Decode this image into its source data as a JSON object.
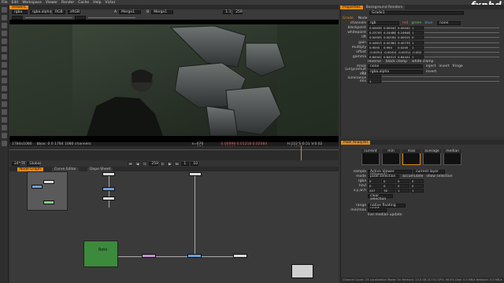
{
  "menu": [
    "File",
    "Edit",
    "Workspace",
    "Viewer",
    "Render",
    "Cache",
    "Help",
    "Victor"
  ],
  "viewer_tab": "Viewer1",
  "viewer_bar": {
    "layer": "rgba",
    "channel": "rgba.alpha",
    "colorspace": "RGB",
    "display": "sRGB",
    "input_a": "A",
    "node_a": "Merge1",
    "input_b": "B",
    "node_b": "Merge1",
    "zoom": "1:1",
    "frame": "259"
  },
  "viewer_info": {
    "res": "1784x1080",
    "bbox": "bbox: 0 0 1784 1080 channels: rgba",
    "coords": "x=676 y=576",
    "values": "0.00098  0.01218  0.02084  1.00000",
    "hsv": "H:222 S:0.51 V:0.02 L:0.0137"
  },
  "transport": {
    "frame": "24*",
    "tf": "TF",
    "global": "Global",
    "in": "1",
    "out": "10",
    "current": "259"
  },
  "graph_tabs": [
    "Node Graph",
    "Curve Editor",
    "Dope Sheet"
  ],
  "graph_nodes": {
    "roto_label": "Roto"
  },
  "props_tabs": [
    "Properties",
    "Background Renders"
  ],
  "grade": {
    "name": "Grade1",
    "tabs": [
      "Grade",
      "Node"
    ],
    "channels": {
      "label": "channels",
      "value": "rgb",
      "opts": [
        "red",
        "green",
        "blue",
        "none"
      ]
    },
    "rows": [
      {
        "label": "blackpoint",
        "v": [
          "0.000394",
          "0.000407",
          "0.000407",
          "1"
        ]
      },
      {
        "label": "whitepoint",
        "v": [
          "0.23705",
          "0.244882",
          "0.246482",
          "1"
        ]
      },
      {
        "label": "lift",
        "v": [
          "0.000058",
          "0.001843",
          "0.000159",
          "0"
        ]
      },
      {
        "label": "gain",
        "v": [
          "0.446134",
          "0.423609",
          "0.407397",
          "1"
        ]
      },
      {
        "label": "multiply",
        "v": [
          "0.9555",
          "0.994",
          "0.0205",
          "1"
        ]
      },
      {
        "label": "offset",
        "v": [
          "-0.003187",
          "-0.004187",
          "-0.003187",
          "-0.002"
        ]
      },
      {
        "label": "gamma",
        "v": [
          "0.840415",
          "0.845133",
          "0.844413",
          "1"
        ]
      }
    ],
    "reverse": "reverse",
    "clamp": "black clamp",
    "white_clamp": "white clamp",
    "mask": {
      "label": "mask",
      "value": "none",
      "inject": "inject",
      "invert": "invert",
      "fringe": "fringe"
    },
    "unpremult": {
      "label": "(un)premult by",
      "value": "rgba.alpha",
      "invert": "invert"
    },
    "mix_luminance": "mix luminance",
    "mix": {
      "label": "mix",
      "value": "1"
    }
  },
  "pixel_analyzer": {
    "title": "Pixel Analyzer",
    "swatches": [
      "current",
      "min",
      "max",
      "average",
      "median"
    ],
    "sample": {
      "label": "sample",
      "value": "Active Viewer (Viewer1)",
      "layer": "current layer"
    },
    "mode": {
      "label": "mode",
      "value": "pixel selection",
      "accumulate": "accumulate",
      "show": "show selection"
    },
    "rgba": {
      "label": "rgba",
      "v": [
        "0",
        "0",
        "0",
        "0"
      ]
    },
    "hsvl": {
      "label": "hsvl",
      "v": [
        "0",
        "0",
        "0",
        "0"
      ]
    },
    "xywh": {
      "label": "x,y,w,h",
      "v": [
        "547",
        "76",
        "1",
        "1"
      ]
    },
    "clear": "clear selection",
    "range": {
      "label": "range",
      "value": "native floating point"
    },
    "minmax": {
      "label": "min/max",
      "value": ""
    },
    "live": "live median update"
  },
  "status": "Channel Count: 25  Localization Mode: On  Memory: 13.0 GB (5.1%)  CPU: 46.0%  Disk: 0.0 MB/s  Network: 0.0 MB/s",
  "logo": "fxphd",
  "colors": {
    "accent": "#e08a1e",
    "roto": "#3c8a3c"
  }
}
